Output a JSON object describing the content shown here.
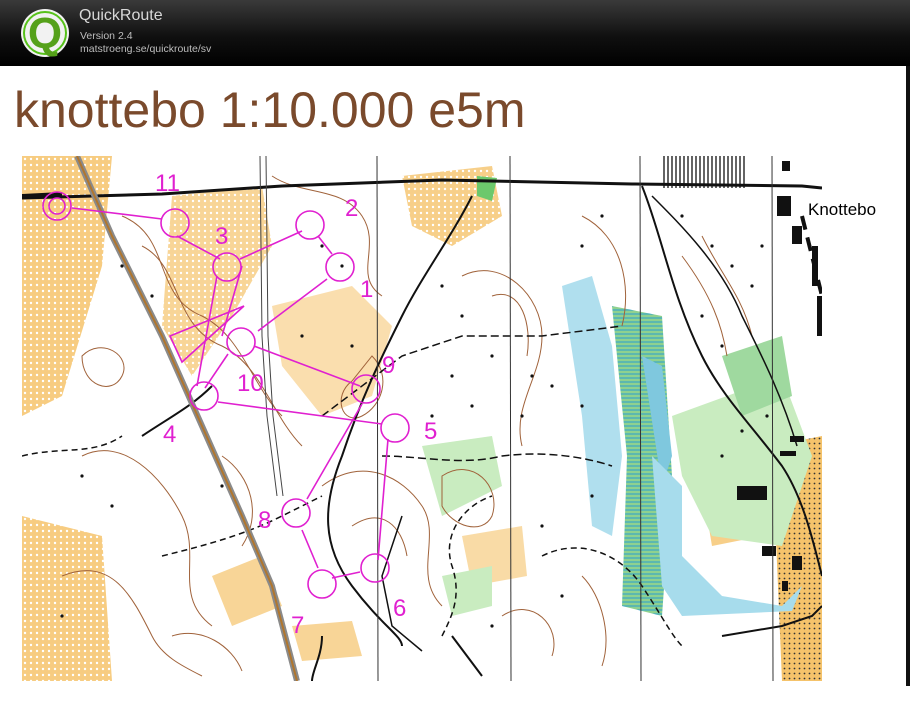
{
  "app": {
    "name": "QuickRoute",
    "version": "Version 2.4",
    "url": "matstroeng.se/quickroute/sv",
    "logo_letter": "Q"
  },
  "map": {
    "title": "knottebo 1:10.000 e5m",
    "place_label": "Knottebo",
    "control_numbers": [
      "1",
      "2",
      "3",
      "4",
      "5",
      "6",
      "7",
      "8",
      "9",
      "10",
      "11"
    ],
    "colors": {
      "course": "#e020d0",
      "title": "#7a4a2c",
      "yellow": "#f5c36b",
      "green": "#9fd99f",
      "water": "#a7dcec",
      "contour": "#a0623a",
      "path": "#111111"
    }
  }
}
